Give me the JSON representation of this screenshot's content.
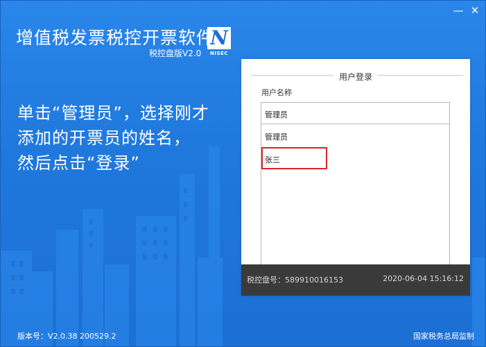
{
  "window": {
    "minimize_symbol": "—",
    "close_symbol": "✕"
  },
  "header": {
    "title": "增值税发票税控开票软件",
    "version": "税控盘版V2.0",
    "logo_letter": "N",
    "logo_text": "NISEC"
  },
  "instruction": {
    "lines": [
      "单击“管理员”，选择刚才",
      "添加的开票员的姓名，",
      "然后点击“登录”"
    ]
  },
  "login": {
    "title": "用户登录",
    "username_label": "用户名称",
    "selected_value": "管理员",
    "options": [
      "管理员",
      "张三"
    ],
    "highlighted_option": "张三"
  },
  "status": {
    "disk_no": "税控盘号：589910016153",
    "datetime": "2020-06-04 15:16:12"
  },
  "footer": {
    "version": "版本号：V2.0.38 200529.2",
    "supervisor": "国家税务总局监制"
  },
  "colors": {
    "background": "#1f78dc",
    "highlight_border": "#d9262c",
    "statusbar": "#3a3a3a"
  }
}
